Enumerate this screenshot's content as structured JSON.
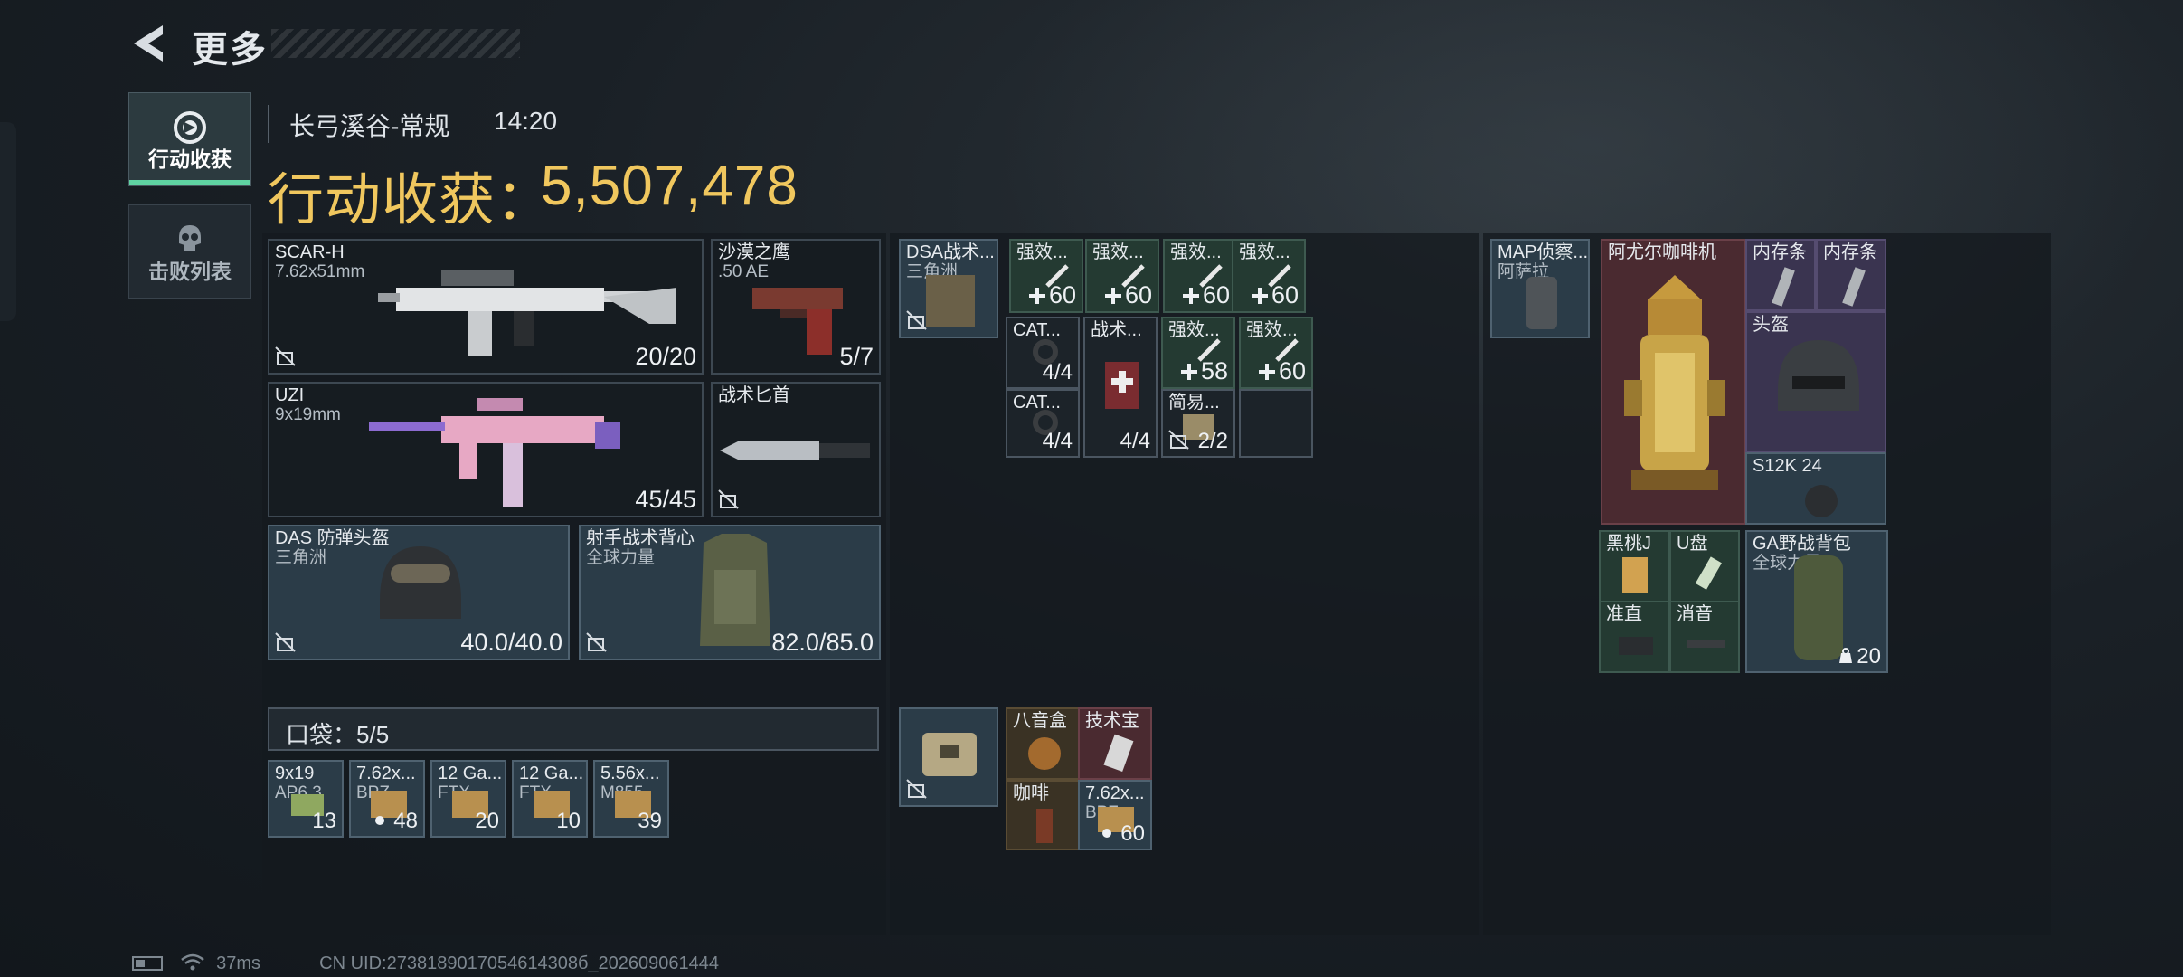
{
  "header": {
    "title": "更多"
  },
  "tabs": [
    {
      "label": "行动收获",
      "active": true,
      "icon": "loot-icon"
    },
    {
      "label": "击败列表",
      "active": false,
      "icon": "skull-icon"
    }
  ],
  "raid": {
    "map": "长弓溪谷-常规",
    "time": "14:20",
    "earnings_label": "行动收获：",
    "earnings_value": "5,507,478"
  },
  "loadout": {
    "scar": {
      "name": "SCAR-H",
      "caliber": "7.62x51mm",
      "ammo": "20/20"
    },
    "deagle": {
      "name": "沙漠之鹰",
      "caliber": ".50 AE",
      "ammo": "5/7"
    },
    "uzi": {
      "name": "UZI",
      "caliber": "9x19mm",
      "ammo": "45/45"
    },
    "knife": {
      "name": "战术匕首"
    },
    "helmet": {
      "name": "DAS 防弹头盔",
      "brand": "三角洲",
      "durability": "40.0/40.0"
    },
    "vest": {
      "name": "射手战术背心",
      "brand": "全球力量",
      "durability": "82.0/85.0"
    },
    "pocket": {
      "label": "口袋：",
      "count": "5/5"
    },
    "pocket_items": [
      {
        "name": "9x19",
        "sub": "AP6.3",
        "count": "13",
        "dot": false
      },
      {
        "name": "7.62x...",
        "sub": "BPZ",
        "count": "48",
        "dot": true
      },
      {
        "name": "12 Ga...",
        "sub": "FTX",
        "count": "20",
        "dot": false
      },
      {
        "name": "12 Ga...",
        "sub": "FTX",
        "count": "10",
        "dot": false
      },
      {
        "name": "5.56x...",
        "sub": "M855",
        "count": "39",
        "dot": false
      }
    ]
  },
  "rig": {
    "name": "DSA战术...",
    "brand": "三角洲",
    "items": [
      {
        "name": "强效...",
        "count": "60"
      },
      {
        "name": "强效...",
        "count": "60"
      },
      {
        "name": "强效...",
        "count": "60"
      },
      {
        "name": "强效...",
        "count": "60"
      },
      {
        "name": "CAT...",
        "count": "4/4"
      },
      {
        "name": "战术...",
        "count": "4/4"
      },
      {
        "name": "强效...",
        "count": "58"
      },
      {
        "name": "强效...",
        "count": "60"
      },
      {
        "name": "CAT...",
        "count": "4/4"
      },
      {
        "name": "简易...",
        "count": "2/2"
      }
    ]
  },
  "case": {
    "items": [
      {
        "name": "八音盒"
      },
      {
        "name": "技术宝"
      },
      {
        "name": "咖啡"
      },
      {
        "name": "7.62x...",
        "sub": "BPZ",
        "count": "60"
      }
    ]
  },
  "backpack_col": {
    "map_device": {
      "name": "MAP侦察...",
      "brand": "阿萨拉"
    },
    "coffee_machine": {
      "name": "阿尤尔咖啡机"
    },
    "memory1": {
      "name": "内存条"
    },
    "memory2": {
      "name": "内存条"
    },
    "helmet2": {
      "name": "头盔"
    },
    "s12k": {
      "name": "S12K 24"
    },
    "black_peach": {
      "name": "黑桃J"
    },
    "usb": {
      "name": "U盘"
    },
    "scope": {
      "name": "准直"
    },
    "suppressor": {
      "name": "消音"
    },
    "backpack": {
      "name": "GA野战背包",
      "brand": "全球力量",
      "count": "20"
    }
  },
  "status": {
    "ping": "37ms",
    "uid": "CN UID:2738189017054614308б_202609061444"
  }
}
